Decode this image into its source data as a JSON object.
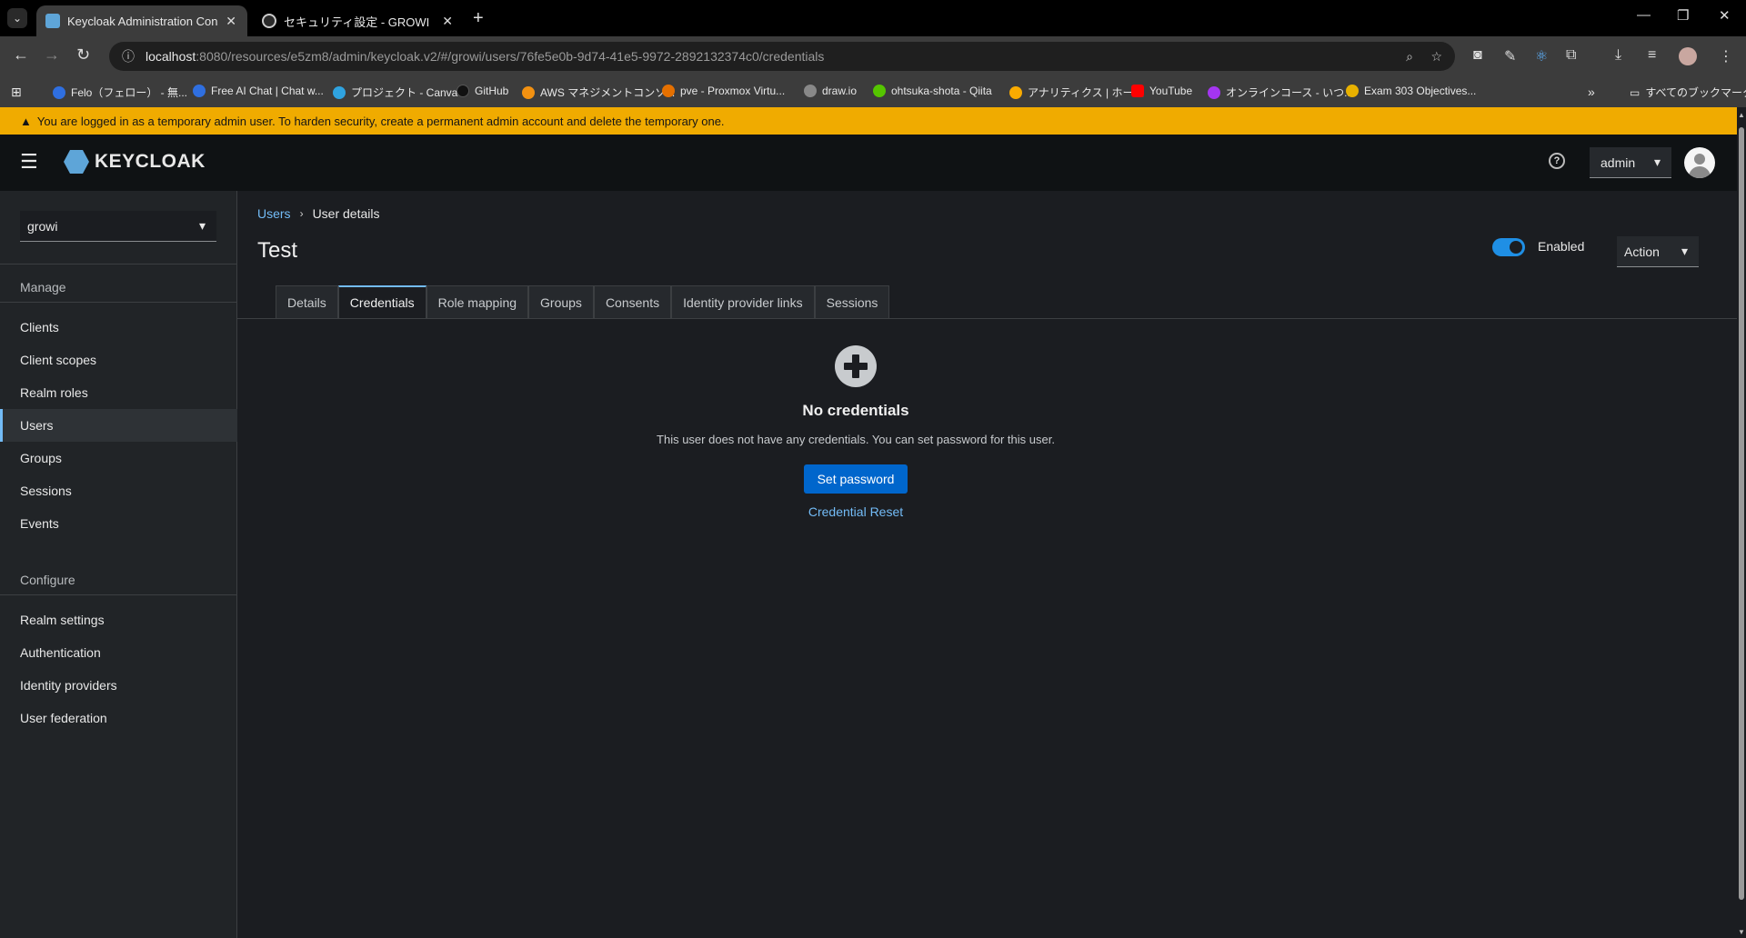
{
  "browser": {
    "tabs": [
      {
        "title": "Keycloak Administration Console",
        "active": true,
        "favicon_color": "#5ea5d8"
      },
      {
        "title": "セキュリティ設定 - GROWI",
        "active": false,
        "favicon_color": "#cccccc"
      }
    ],
    "url_host": "localhost",
    "url_rest": ":8080/resources/e5zm8/admin/keycloak.v2/#/growi/users/76fe5e0b-9d74-41e5-9972-2892132374c0/credentials",
    "bookmarks": [
      {
        "label": "Felo（フェロー） - 無...",
        "color": "#2f6fe0"
      },
      {
        "label": "Free AI Chat | Chat w...",
        "color": "#2f6fe0"
      },
      {
        "label": "プロジェクト - Canva",
        "color": "#2fa3e0"
      },
      {
        "label": "GitHub",
        "color": "#111111"
      },
      {
        "label": "AWS マネジメントコンソ...",
        "color": "#f29111"
      },
      {
        "label": "pve - Proxmox Virtu...",
        "color": "#e57000"
      },
      {
        "label": "draw.io",
        "color": "#888888"
      },
      {
        "label": "ohtsuka-shota - Qiita",
        "color": "#55c500"
      },
      {
        "label": "アナリティクス | ホーム",
        "color": "#f9ab00"
      },
      {
        "label": "YouTube",
        "color": "#ff0000"
      },
      {
        "label": "オンラインコース - いつ...",
        "color": "#a435f0"
      },
      {
        "label": "Exam 303 Objectives...",
        "color": "#e8b100"
      }
    ],
    "bookmarks_folder": "すべてのブックマーク"
  },
  "banner": {
    "text": "You are logged in as a temporary admin user. To harden security, create a permanent admin account and delete the temporary one."
  },
  "header": {
    "logo_text": "KEYCLOAK",
    "user_menu": "admin"
  },
  "sidebar": {
    "realm": "growi",
    "manage_label": "Manage",
    "manage_items": [
      "Clients",
      "Client scopes",
      "Realm roles",
      "Users",
      "Groups",
      "Sessions",
      "Events"
    ],
    "configure_label": "Configure",
    "configure_items": [
      "Realm settings",
      "Authentication",
      "Identity providers",
      "User federation"
    ]
  },
  "main": {
    "breadcrumb": {
      "parent": "Users",
      "current": "User details"
    },
    "title": "Test",
    "enabled_label": "Enabled",
    "action_label": "Action",
    "tabs": [
      "Details",
      "Credentials",
      "Role mapping",
      "Groups",
      "Consents",
      "Identity provider links",
      "Sessions"
    ],
    "active_tab": "Credentials",
    "empty_state": {
      "title": "No credentials",
      "body": "This user does not have any credentials. You can set password for this user.",
      "primary_button": "Set password",
      "link_button": "Credential Reset"
    }
  }
}
